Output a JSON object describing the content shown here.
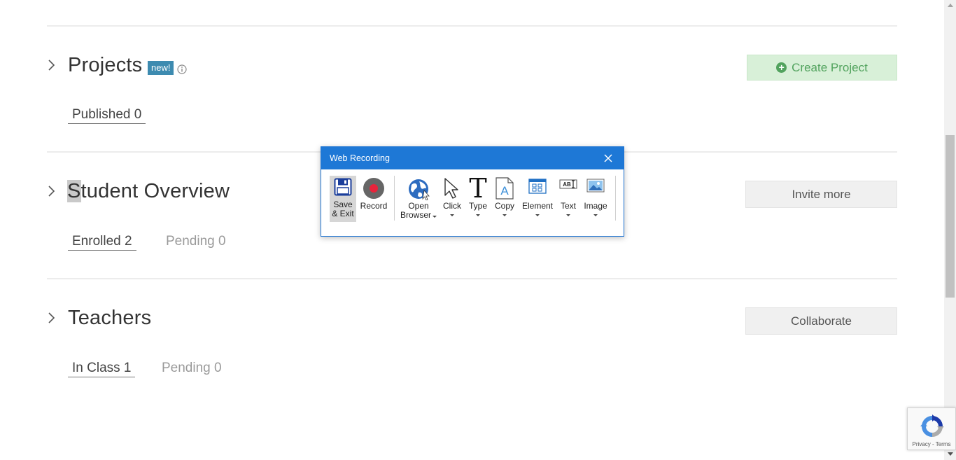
{
  "sections": {
    "projects": {
      "title": "Projects",
      "badge": "new!",
      "tabs": [
        {
          "label": "Published 0"
        }
      ],
      "action": "Create Project"
    },
    "students": {
      "title_first": "S",
      "title_rest": "tudent Overview",
      "tabs": [
        {
          "label": "Enrolled 2"
        },
        {
          "label": "Pending 0"
        }
      ],
      "action": "Invite more"
    },
    "teachers": {
      "title": "Teachers",
      "tabs": [
        {
          "label": "In Class 1"
        },
        {
          "label": "Pending 0"
        }
      ],
      "action": "Collaborate"
    }
  },
  "recorder": {
    "title": "Web Recording",
    "tools": [
      {
        "label1": "Save",
        "label2": "& Exit",
        "icon": "save-icon"
      },
      {
        "label1": "Record",
        "icon": "record-icon"
      },
      {
        "label1": "Open",
        "label2": "Browser",
        "icon": "globe-icon"
      },
      {
        "label1": "Click",
        "icon": "cursor-icon"
      },
      {
        "label1": "Type",
        "icon": "type-icon"
      },
      {
        "label1": "Copy",
        "icon": "copy-icon"
      },
      {
        "label1": "Element",
        "icon": "element-icon"
      },
      {
        "label1": "Text",
        "icon": "text-icon"
      },
      {
        "label1": "Image",
        "icon": "image-icon"
      }
    ]
  },
  "recaptcha": {
    "links": "Privacy - Terms"
  },
  "colors": {
    "accent": "#1e78d6",
    "success": "#52a35e",
    "badge": "#3d8bb0"
  }
}
